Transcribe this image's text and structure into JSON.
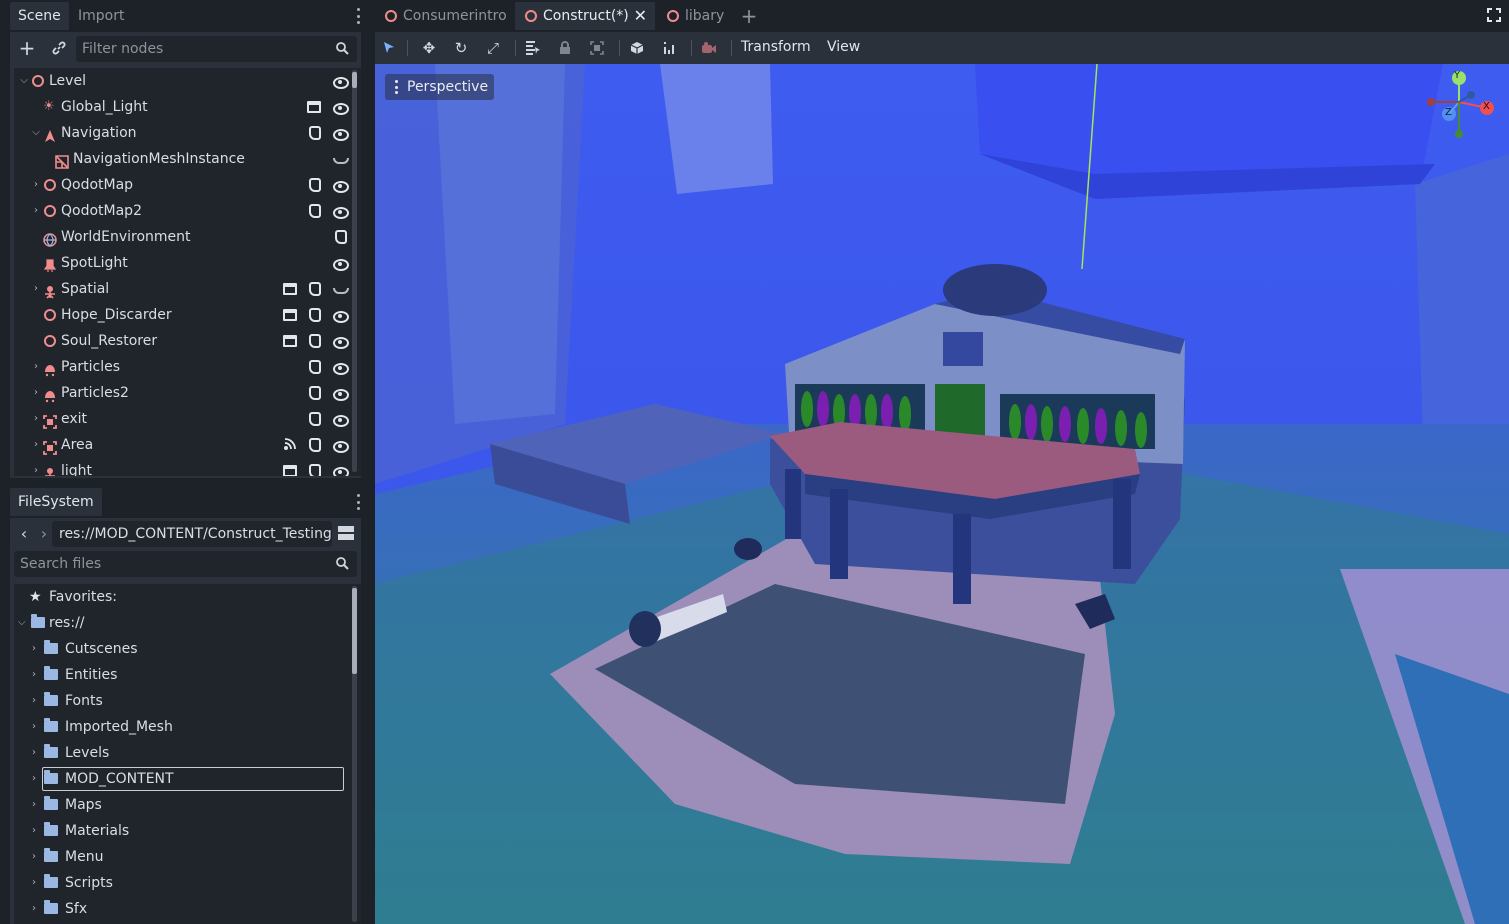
{
  "scene_dock": {
    "tabs": [
      "Scene",
      "Import"
    ],
    "filter_placeholder": "Filter nodes",
    "nodes": [
      {
        "label": "Level"
      },
      {
        "label": "Global_Light"
      },
      {
        "label": "Navigation"
      },
      {
        "label": "NavigationMeshInstance"
      },
      {
        "label": "QodotMap"
      },
      {
        "label": "QodotMap2"
      },
      {
        "label": "WorldEnvironment"
      },
      {
        "label": "SpotLight"
      },
      {
        "label": "Spatial"
      },
      {
        "label": "Hope_Discarder"
      },
      {
        "label": "Soul_Restorer"
      },
      {
        "label": "Particles"
      },
      {
        "label": "Particles2"
      },
      {
        "label": "exit"
      },
      {
        "label": "Area"
      },
      {
        "label": "light"
      }
    ]
  },
  "filesystem_dock": {
    "tab": "FileSystem",
    "path": "res://MOD_CONTENT/Construct_Testing",
    "search_placeholder": "Search files",
    "favorites_label": "Favorites:",
    "root_label": "res://",
    "folders": [
      "Cutscenes",
      "Entities",
      "Fonts",
      "Imported_Mesh",
      "Levels",
      "MOD_CONTENT",
      "Maps",
      "Materials",
      "Menu",
      "Scripts",
      "Sfx"
    ],
    "selected_folder": "MOD_CONTENT"
  },
  "scene_tabs": [
    {
      "label": "Consumerintro"
    },
    {
      "label": "Construct(*)"
    },
    {
      "label": "libary"
    }
  ],
  "active_scene_tab": "Construct(*)",
  "toolbar": {
    "transform_menu": "Transform",
    "view_menu": "View"
  },
  "viewport": {
    "perspective_label": "Perspective",
    "gizmo_axes": {
      "y": "Y",
      "x": "X",
      "z": "Z"
    }
  },
  "colors": {
    "accent_node": "#f08c8c",
    "folder": "#9bb7e3",
    "panel": "#2b313a",
    "background": "#1d2229"
  }
}
